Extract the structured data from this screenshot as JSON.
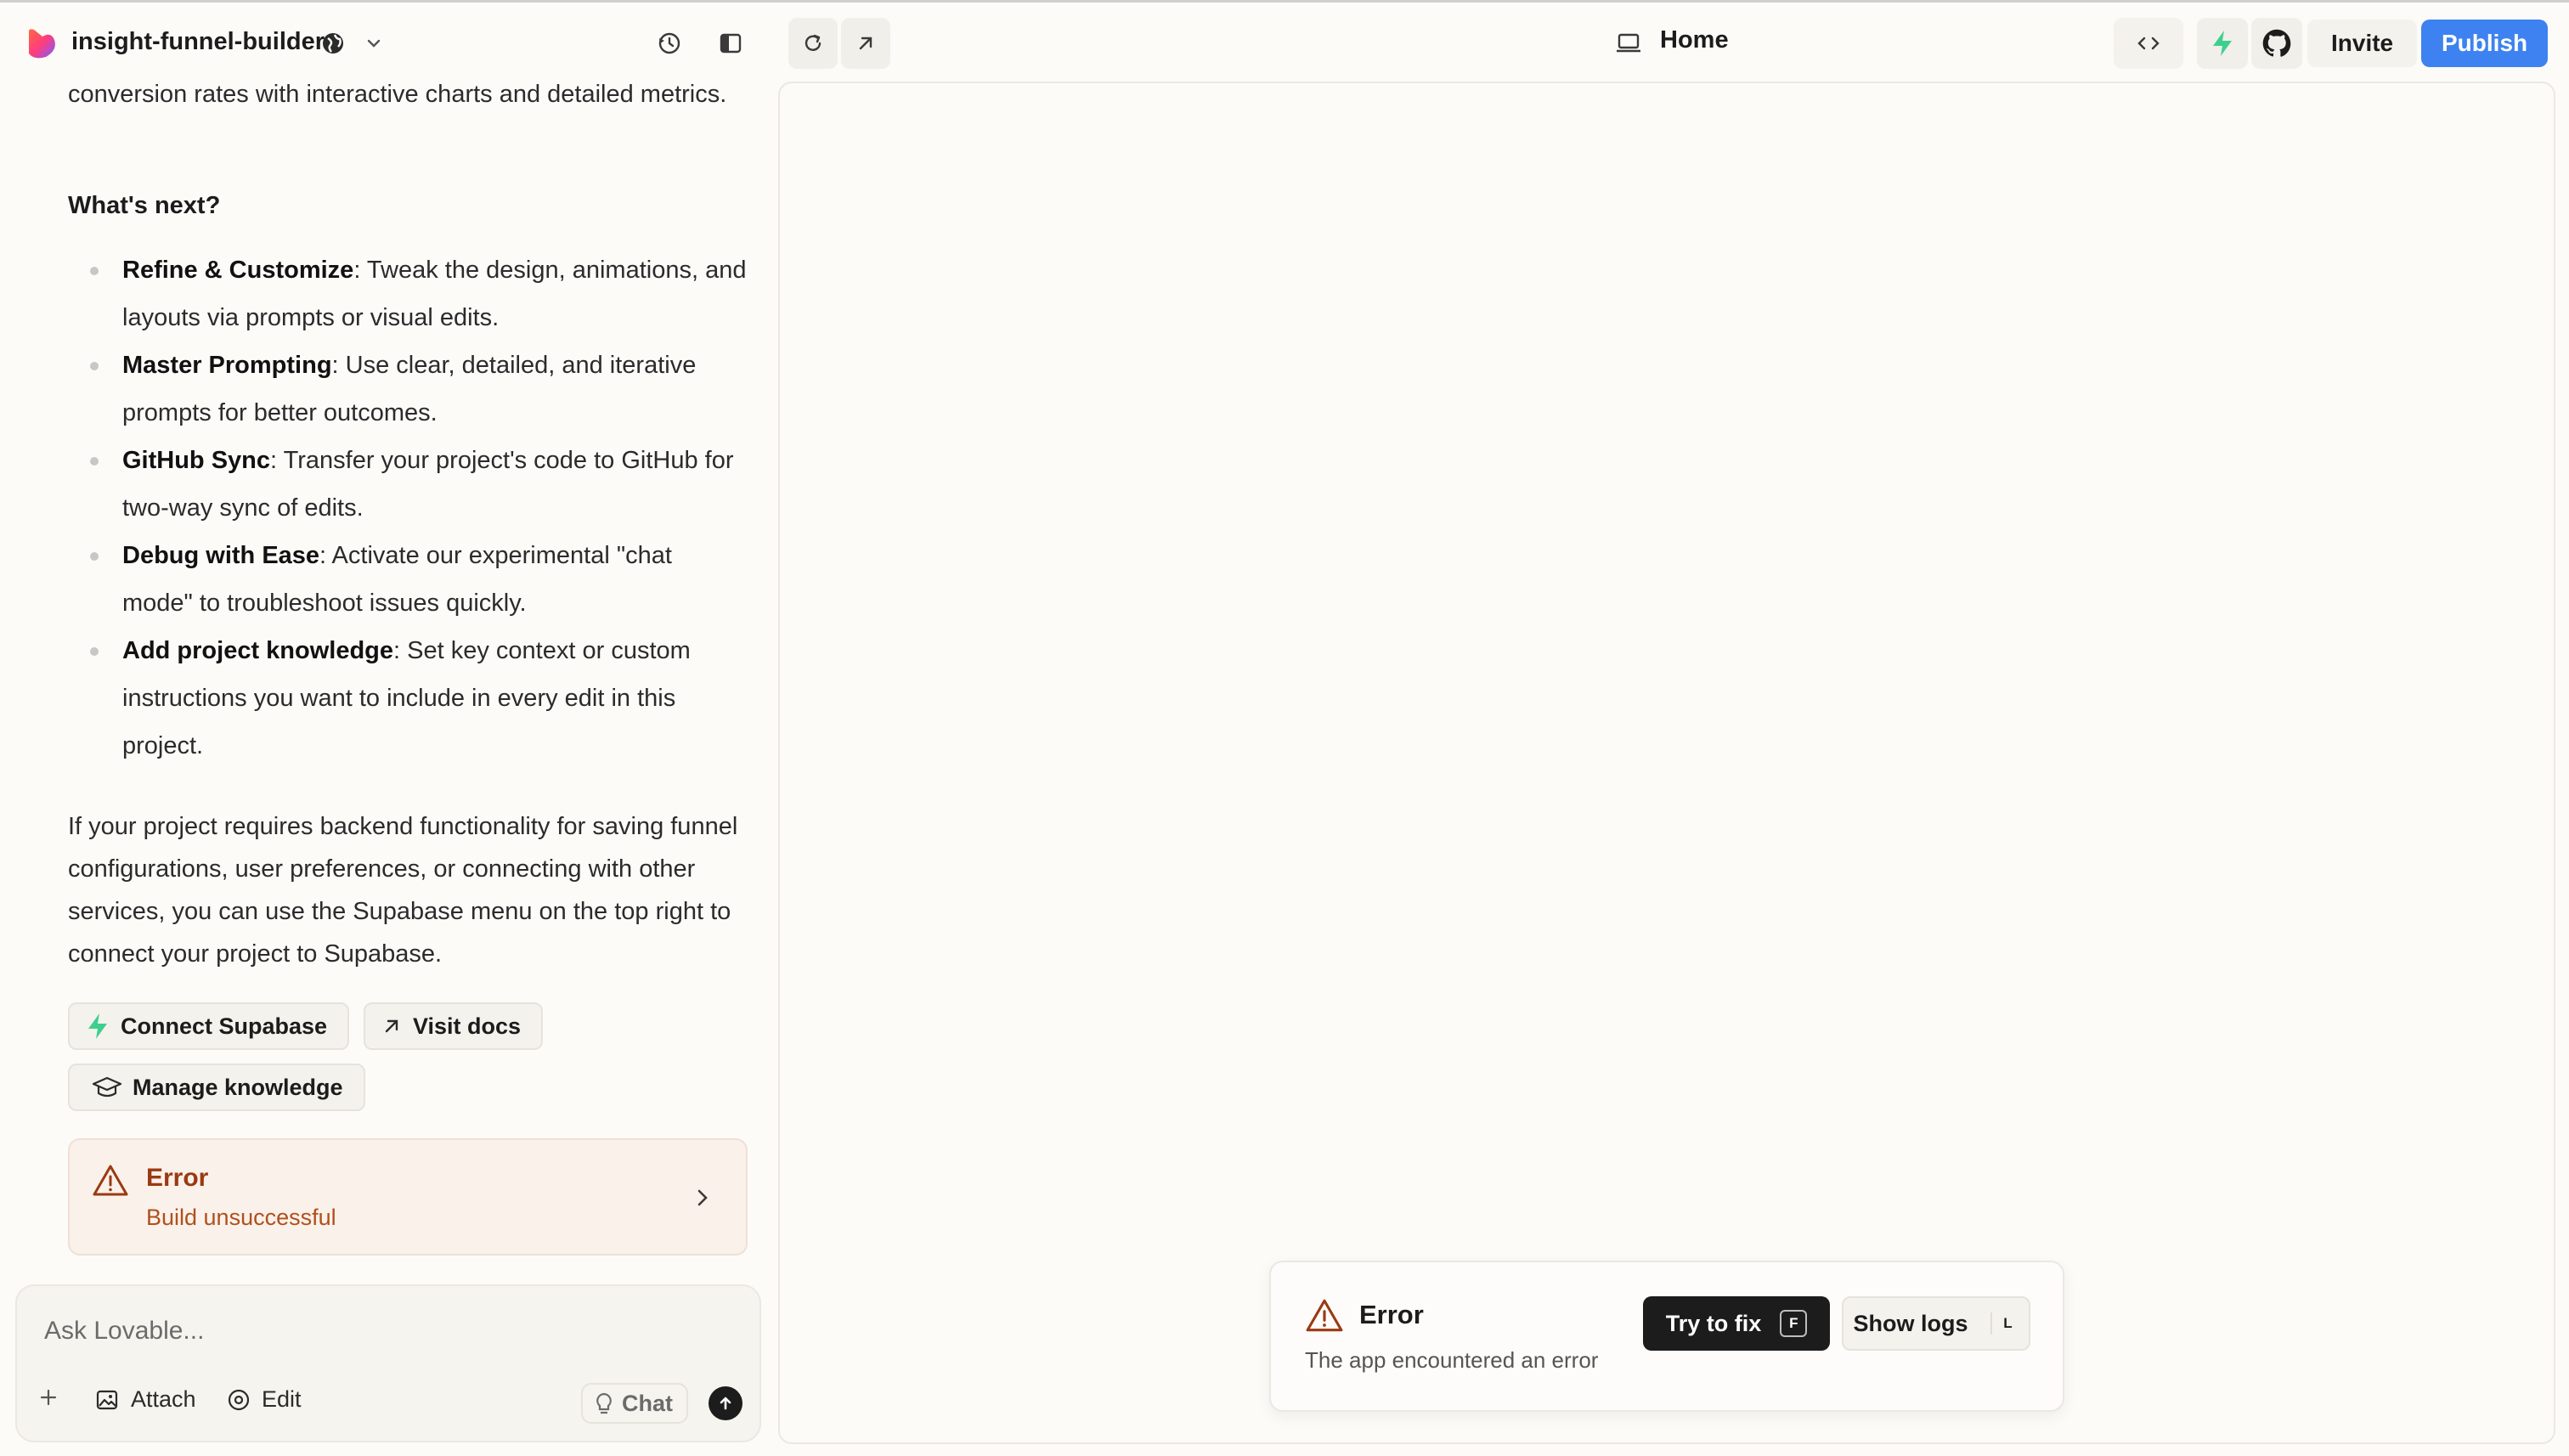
{
  "header": {
    "project_name": "insight-funnel-builder",
    "route": "Home",
    "invite_label": "Invite",
    "publish_label": "Publish",
    "accent_color": "#3d82f0"
  },
  "chat": {
    "intro_text": "conversion rates with interactive charts and detailed metrics.",
    "next_heading": "What's next?",
    "tips": [
      {
        "title": "Refine & Customize",
        "text": ": Tweak the design, animations, and layouts via prompts or visual edits."
      },
      {
        "title": "Master Prompting",
        "text": ": Use clear, detailed, and iterative prompts for better outcomes."
      },
      {
        "title": "GitHub Sync",
        "text": ": Transfer your project's code to GitHub for two-way sync of edits."
      },
      {
        "title": "Debug with Ease",
        "text": ": Activate our experimental \"chat mode\" to troubleshoot issues quickly."
      },
      {
        "title": "Add project knowledge",
        "text": ": Set key context or custom instructions you want to include in every edit in this project."
      }
    ],
    "backend_text": "If your project requires backend functionality for saving funnel configurations, user preferences, or connecting with other services, you can use the Supabase menu on the top right to connect your project to Supabase.",
    "actions": {
      "connect_supabase": "Connect Supabase",
      "visit_docs": "Visit docs",
      "manage_knowledge": "Manage knowledge"
    },
    "error_card": {
      "title": "Error",
      "subtitle": "Build unsuccessful"
    }
  },
  "composer": {
    "placeholder": "Ask Lovable...",
    "attach_label": "Attach",
    "edit_label": "Edit",
    "chat_label": "Chat"
  },
  "preview": {
    "toast": {
      "title": "Error",
      "message": "The app encountered an error",
      "try_fix_label": "Try to fix",
      "try_fix_key": "F",
      "show_logs_label": "Show logs",
      "show_logs_key": "L"
    }
  },
  "colors": {
    "supabase_green": "#3ecf8e",
    "error_red": "#9a3a12"
  }
}
